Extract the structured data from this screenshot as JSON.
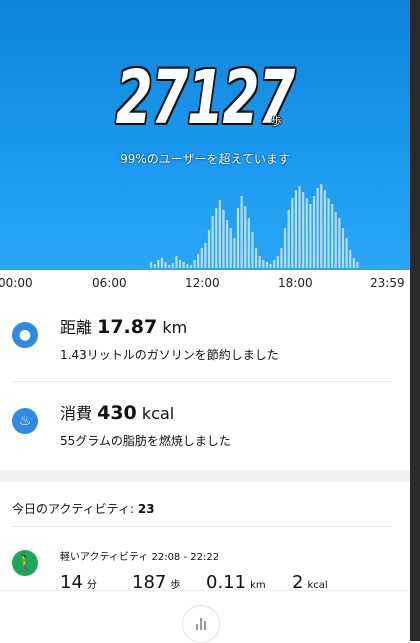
{
  "header": {
    "steps": "27127",
    "steps_unit": "歩",
    "rank_text": "99%のユーザーを超えています",
    "colors": {
      "background": "#1b9af0",
      "bars": "#cfe8ff"
    }
  },
  "time_axis": [
    "00:00",
    "06:00",
    "12:00",
    "18:00",
    "23:59"
  ],
  "distance": {
    "icon": "location-pin-icon",
    "label": "距離",
    "value": "17.87",
    "unit": "km",
    "note": "1.43リットルのガソリンを節約しました"
  },
  "calories": {
    "icon": "flame-icon",
    "label": "消費",
    "value": "430",
    "unit": "kcal",
    "note": "55グラムの脂肪を燃焼しました"
  },
  "activity": {
    "header_label": "今日のアクティビティ:",
    "count": "23",
    "item": {
      "icon": "walking-person-icon",
      "title": "軽いアクティビティ 22:08 - 22:22",
      "minutes": "14",
      "minutes_unit": "分",
      "steps": "187",
      "steps_unit": "歩",
      "distance": "0.11",
      "distance_unit": "km",
      "calories": "2",
      "calories_unit": "kcal"
    }
  },
  "bottom_bar": {
    "icon": "chart-bars-icon"
  }
}
